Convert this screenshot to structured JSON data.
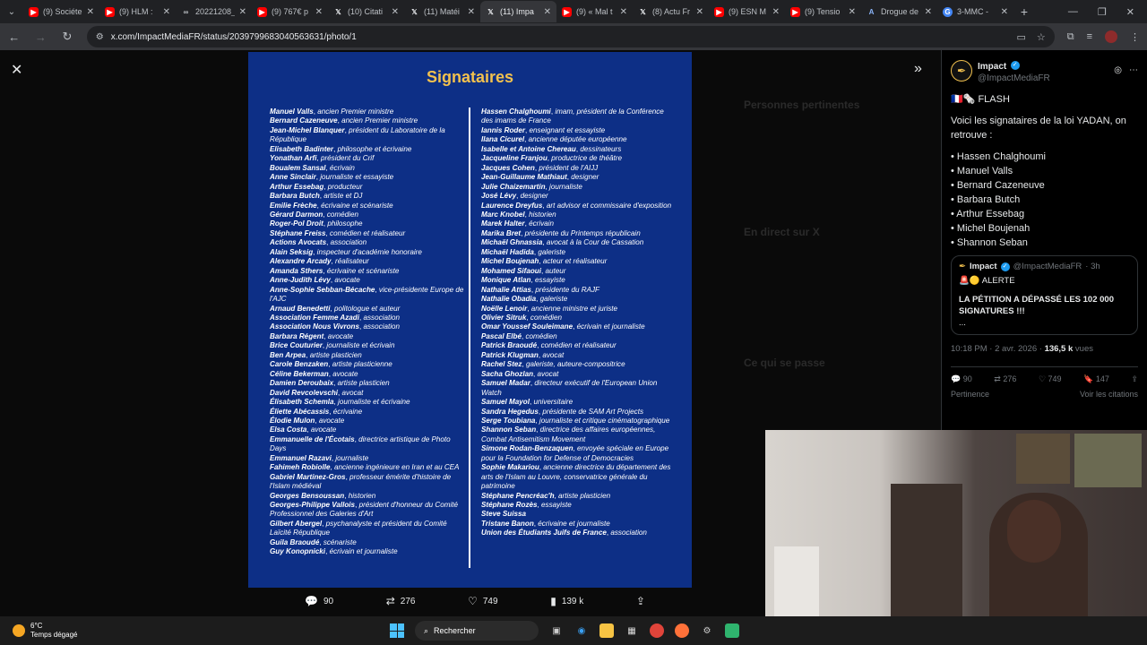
{
  "browser": {
    "tabs": [
      {
        "label": "(9) Sociéte",
        "icon": "youtube-icon",
        "active": false
      },
      {
        "label": "(9) HLM :",
        "icon": "youtube-icon",
        "active": false
      },
      {
        "label": "20221208_",
        "icon": "link-icon",
        "active": false
      },
      {
        "label": "(9) 767€ p",
        "icon": "youtube-icon",
        "active": false
      },
      {
        "label": "(10) Citati",
        "icon": "x-icon",
        "active": false
      },
      {
        "label": "(11) Matéi",
        "icon": "x-icon",
        "active": false
      },
      {
        "label": "(11) Impa",
        "icon": "x-icon",
        "active": true
      },
      {
        "label": "(9) « Mal t",
        "icon": "youtube-icon",
        "active": false
      },
      {
        "label": "(8) Actu Fr",
        "icon": "x-icon",
        "active": false
      },
      {
        "label": "(9) ESN M",
        "icon": "youtube-icon",
        "active": false
      },
      {
        "label": "(9) Tensio",
        "icon": "youtube-icon",
        "active": false
      },
      {
        "label": "Drogue de",
        "icon": "article-icon",
        "active": false
      },
      {
        "label": "3-MMC - ",
        "icon": "google-icon",
        "active": false
      }
    ],
    "url": "x.com/ImpactMediaFR/status/2039799683040563631/photo/1"
  },
  "photo": {
    "title": "Signataires",
    "left_column": [
      {
        "name": "Manuel Valls",
        "desc": "ancien Premier ministre"
      },
      {
        "name": "Bernard Cazeneuve",
        "desc": "ancien Premier ministre"
      },
      {
        "name": "Jean-Michel Blanquer",
        "desc": "président du Laboratoire de la République"
      },
      {
        "name": "Elisabeth Badinter",
        "desc": "philosophe et écrivaine"
      },
      {
        "name": "Yonathan Arfi",
        "desc": "président du Crif"
      },
      {
        "name": "Boualem Sansal",
        "desc": "écrivain"
      },
      {
        "name": "Anne Sinclair",
        "desc": "journaliste et essayiste"
      },
      {
        "name": "Arthur Essebag",
        "desc": "producteur"
      },
      {
        "name": "Barbara Butch",
        "desc": "artiste et DJ"
      },
      {
        "name": "Emilie Frèche",
        "desc": "écrivaine et scénariste"
      },
      {
        "name": "Gérard Darmon",
        "desc": "comédien"
      },
      {
        "name": "Roger-Pol Droit",
        "desc": "philosophe"
      },
      {
        "name": "Stéphane Freiss",
        "desc": "comédien et réalisateur"
      },
      {
        "name": "Actions Avocats",
        "desc": "association"
      },
      {
        "name": "Alain Seksig",
        "desc": "inspecteur d'académie honoraire"
      },
      {
        "name": "Alexandre Arcady",
        "desc": "réalisateur"
      },
      {
        "name": "Amanda Sthers",
        "desc": "écrivaine et scénariste"
      },
      {
        "name": "Anne-Judith Lévy",
        "desc": "avocate"
      },
      {
        "name": "Anne-Sophie Sebban-Bécache",
        "desc": "vice-présidente Europe de l'AJC"
      },
      {
        "name": "Arnaud Benedetti",
        "desc": "politologue et auteur"
      },
      {
        "name": "Association Femme Azadi",
        "desc": "association"
      },
      {
        "name": "Association Nous Vivrons",
        "desc": "association"
      },
      {
        "name": "Barbara Régent",
        "desc": "avocate"
      },
      {
        "name": "Brice Couturier",
        "desc": "journaliste et écrivain"
      },
      {
        "name": "Ben Arpea",
        "desc": "artiste plasticien"
      },
      {
        "name": "Carole Benzaken",
        "desc": "artiste plasticienne"
      },
      {
        "name": "Céline Bekerman",
        "desc": "avocate"
      },
      {
        "name": "Damien Deroubaix",
        "desc": "artiste plasticien"
      },
      {
        "name": "David Revcolevschi",
        "desc": "avocat"
      },
      {
        "name": "Élisabeth Schemla",
        "desc": "journaliste et écrivaine"
      },
      {
        "name": "Éliette Abécassis",
        "desc": "écrivaine"
      },
      {
        "name": "Élodie Mulon",
        "desc": "avocate"
      },
      {
        "name": "Elsa Costa",
        "desc": "avocate"
      },
      {
        "name": "Emmanuelle de l'Écotais",
        "desc": "directrice artistique de Photo Days"
      },
      {
        "name": "Emmanuel Razavi",
        "desc": "journaliste"
      },
      {
        "name": "Fahimeh Robiolle",
        "desc": "ancienne ingénieure en Iran et au CEA"
      },
      {
        "name": "Gabriel Martinez-Gros",
        "desc": "professeur émérite d'histoire de l'Islam médiéval"
      },
      {
        "name": "Georges Bensoussan",
        "desc": "historien"
      },
      {
        "name": "Georges-Philippe Vallois",
        "desc": "président d'honneur du Comité Professionnel des Galeries d'Art"
      },
      {
        "name": "Gilbert Abergel",
        "desc": "psychanalyste et président du Comité Laïcité République"
      },
      {
        "name": "Guila Braoudé",
        "desc": "scénariste"
      },
      {
        "name": "Guy Konopnicki",
        "desc": "écrivain et journaliste"
      }
    ],
    "right_column": [
      {
        "name": "Hassen Chalghoumi",
        "desc": "imam, président de la Conférence des imams de France"
      },
      {
        "name": "Iannis Roder",
        "desc": "enseignant et essayiste"
      },
      {
        "name": "Ilana Cicurel",
        "desc": "ancienne députée européenne"
      },
      {
        "name": "Isabelle et Antoine Chereau",
        "desc": "dessinateurs"
      },
      {
        "name": "Jacqueline Franjou",
        "desc": "productrice de théâtre"
      },
      {
        "name": "Jacques Cohen",
        "desc": "président de l'AIJJ"
      },
      {
        "name": "Jean-Guillaume Mathiaut",
        "desc": "designer"
      },
      {
        "name": "Julie Chaizemartin",
        "desc": "journaliste"
      },
      {
        "name": "José Lévy",
        "desc": "designer"
      },
      {
        "name": "Laurence Dreyfus",
        "desc": "art advisor et commissaire d'exposition"
      },
      {
        "name": "Marc Knobel",
        "desc": "historien"
      },
      {
        "name": "Marek Halter",
        "desc": "écrivain"
      },
      {
        "name": "Marika Bret",
        "desc": "présidente du Printemps républicain"
      },
      {
        "name": "Michaël Ghnassia",
        "desc": "avocat à la Cour de Cassation"
      },
      {
        "name": "Michaël Hadida",
        "desc": "galeriste"
      },
      {
        "name": "Michel Boujenah",
        "desc": "acteur et réalisateur"
      },
      {
        "name": "Mohamed Sifaoui",
        "desc": "auteur"
      },
      {
        "name": "Monique Atlan",
        "desc": "essayiste"
      },
      {
        "name": "Nathalie Attias",
        "desc": "présidente du RAJF"
      },
      {
        "name": "Nathalie Obadia",
        "desc": "galeriste"
      },
      {
        "name": "Noëlle Lenoir",
        "desc": "ancienne ministre et juriste"
      },
      {
        "name": "Olivier Sitruk",
        "desc": "comédien"
      },
      {
        "name": "Omar Youssef Souleimane",
        "desc": "écrivain et journaliste"
      },
      {
        "name": "Pascal Elbé",
        "desc": "comédien"
      },
      {
        "name": "Patrick Braoudé",
        "desc": "comédien et réalisateur"
      },
      {
        "name": "Patrick Klugman",
        "desc": "avocat"
      },
      {
        "name": "Rachel Stez",
        "desc": "galeriste, auteure-compositrice"
      },
      {
        "name": "Sacha Ghozlan",
        "desc": "avocat"
      },
      {
        "name": "Samuel Madar",
        "desc": "directeur exécutif de l'European Union Watch"
      },
      {
        "name": "Samuel Mayol",
        "desc": "universitaire"
      },
      {
        "name": "Sandra Hegedus",
        "desc": "présidente de SAM Art Projects"
      },
      {
        "name": "Serge Toubiana",
        "desc": "journaliste et critique cinématographique"
      },
      {
        "name": "Shannon Seban",
        "desc": "directrice des affaires européennes, Combat Antisemitism Movement"
      },
      {
        "name": "Simone Rodan-Benzaquen",
        "desc": "envoyée spéciale en Europe pour la Foundation for Defense of Democracies"
      },
      {
        "name": "Sophie Makariou",
        "desc": "ancienne directrice du département des arts de l'Islam au Louvre, conservatrice générale du patrimoine"
      },
      {
        "name": "Stéphane Pencréac'h",
        "desc": "artiste plasticien"
      },
      {
        "name": "Stéphane Rozès",
        "desc": "essayiste"
      },
      {
        "name": "Steve Suissa",
        "desc": ""
      },
      {
        "name": "Tristane Banon",
        "desc": "écrivaine et journaliste"
      },
      {
        "name": "Union des Étudiants Juifs de France",
        "desc": "association"
      }
    ]
  },
  "actions": {
    "replies": "90",
    "reposts": "276",
    "likes": "749",
    "views": "139 k"
  },
  "tweet": {
    "author_name": "Impact",
    "handle": "@ImpactMediaFR",
    "flash": "🇫🇷🗞️ FLASH",
    "intro": "Voici les signataires de la loi YADAN, on retrouve :",
    "bullets": [
      "• Hassen Chalghoumi",
      "• Manuel Valls",
      "• Bernard Cazeneuve",
      "• Barbara Butch",
      "• Arthur Essebag",
      "• Michel Boujenah",
      "• Shannon Seban"
    ],
    "quote": {
      "name": "Impact",
      "handle": "@ImpactMediaFR",
      "time": "· 3h",
      "alert": "🚨🟡 ALERTE",
      "body": "LA PÉTITION A DÉPASSÉ LES 102 000 SIGNATURES !!!",
      "more": "..."
    },
    "time": "10:18 PM · 2 avr. 2026 ·",
    "views": "136,5 k",
    "views_label": "vues",
    "stats": {
      "replies": "90",
      "reposts": "276",
      "likes": "749",
      "bookmarks": "147"
    },
    "sort_left": "Pertinence",
    "sort_right": "Voir les citations"
  },
  "taskbar": {
    "temp": "6°C",
    "weather": "Temps dégagé",
    "search": "Rechercher"
  },
  "background_ghost": {
    "relevant": "Personnes pertinentes",
    "live": "En direct sur X",
    "happening": "Ce qui se passe"
  }
}
